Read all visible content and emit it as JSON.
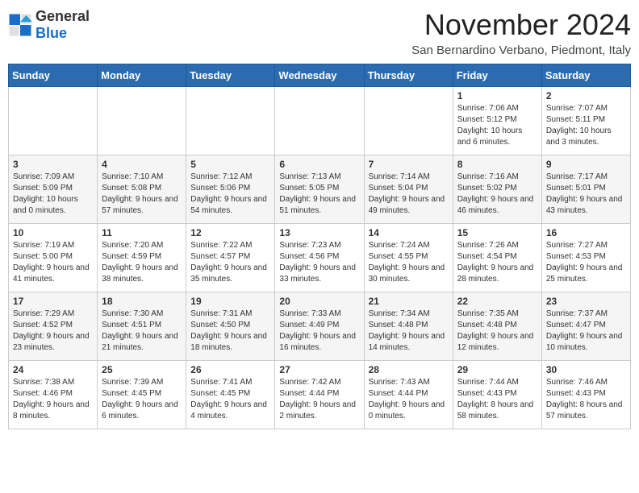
{
  "header": {
    "logo_general": "General",
    "logo_blue": "Blue",
    "month_title": "November 2024",
    "location": "San Bernardino Verbano, Piedmont, Italy"
  },
  "calendar": {
    "weekdays": [
      "Sunday",
      "Monday",
      "Tuesday",
      "Wednesday",
      "Thursday",
      "Friday",
      "Saturday"
    ],
    "rows": [
      [
        {
          "day": "",
          "info": ""
        },
        {
          "day": "",
          "info": ""
        },
        {
          "day": "",
          "info": ""
        },
        {
          "day": "",
          "info": ""
        },
        {
          "day": "",
          "info": ""
        },
        {
          "day": "1",
          "info": "Sunrise: 7:06 AM\nSunset: 5:12 PM\nDaylight: 10 hours and 6 minutes."
        },
        {
          "day": "2",
          "info": "Sunrise: 7:07 AM\nSunset: 5:11 PM\nDaylight: 10 hours and 3 minutes."
        }
      ],
      [
        {
          "day": "3",
          "info": "Sunrise: 7:09 AM\nSunset: 5:09 PM\nDaylight: 10 hours and 0 minutes."
        },
        {
          "day": "4",
          "info": "Sunrise: 7:10 AM\nSunset: 5:08 PM\nDaylight: 9 hours and 57 minutes."
        },
        {
          "day": "5",
          "info": "Sunrise: 7:12 AM\nSunset: 5:06 PM\nDaylight: 9 hours and 54 minutes."
        },
        {
          "day": "6",
          "info": "Sunrise: 7:13 AM\nSunset: 5:05 PM\nDaylight: 9 hours and 51 minutes."
        },
        {
          "day": "7",
          "info": "Sunrise: 7:14 AM\nSunset: 5:04 PM\nDaylight: 9 hours and 49 minutes."
        },
        {
          "day": "8",
          "info": "Sunrise: 7:16 AM\nSunset: 5:02 PM\nDaylight: 9 hours and 46 minutes."
        },
        {
          "day": "9",
          "info": "Sunrise: 7:17 AM\nSunset: 5:01 PM\nDaylight: 9 hours and 43 minutes."
        }
      ],
      [
        {
          "day": "10",
          "info": "Sunrise: 7:19 AM\nSunset: 5:00 PM\nDaylight: 9 hours and 41 minutes."
        },
        {
          "day": "11",
          "info": "Sunrise: 7:20 AM\nSunset: 4:59 PM\nDaylight: 9 hours and 38 minutes."
        },
        {
          "day": "12",
          "info": "Sunrise: 7:22 AM\nSunset: 4:57 PM\nDaylight: 9 hours and 35 minutes."
        },
        {
          "day": "13",
          "info": "Sunrise: 7:23 AM\nSunset: 4:56 PM\nDaylight: 9 hours and 33 minutes."
        },
        {
          "day": "14",
          "info": "Sunrise: 7:24 AM\nSunset: 4:55 PM\nDaylight: 9 hours and 30 minutes."
        },
        {
          "day": "15",
          "info": "Sunrise: 7:26 AM\nSunset: 4:54 PM\nDaylight: 9 hours and 28 minutes."
        },
        {
          "day": "16",
          "info": "Sunrise: 7:27 AM\nSunset: 4:53 PM\nDaylight: 9 hours and 25 minutes."
        }
      ],
      [
        {
          "day": "17",
          "info": "Sunrise: 7:29 AM\nSunset: 4:52 PM\nDaylight: 9 hours and 23 minutes."
        },
        {
          "day": "18",
          "info": "Sunrise: 7:30 AM\nSunset: 4:51 PM\nDaylight: 9 hours and 21 minutes."
        },
        {
          "day": "19",
          "info": "Sunrise: 7:31 AM\nSunset: 4:50 PM\nDaylight: 9 hours and 18 minutes."
        },
        {
          "day": "20",
          "info": "Sunrise: 7:33 AM\nSunset: 4:49 PM\nDaylight: 9 hours and 16 minutes."
        },
        {
          "day": "21",
          "info": "Sunrise: 7:34 AM\nSunset: 4:48 PM\nDaylight: 9 hours and 14 minutes."
        },
        {
          "day": "22",
          "info": "Sunrise: 7:35 AM\nSunset: 4:48 PM\nDaylight: 9 hours and 12 minutes."
        },
        {
          "day": "23",
          "info": "Sunrise: 7:37 AM\nSunset: 4:47 PM\nDaylight: 9 hours and 10 minutes."
        }
      ],
      [
        {
          "day": "24",
          "info": "Sunrise: 7:38 AM\nSunset: 4:46 PM\nDaylight: 9 hours and 8 minutes."
        },
        {
          "day": "25",
          "info": "Sunrise: 7:39 AM\nSunset: 4:45 PM\nDaylight: 9 hours and 6 minutes."
        },
        {
          "day": "26",
          "info": "Sunrise: 7:41 AM\nSunset: 4:45 PM\nDaylight: 9 hours and 4 minutes."
        },
        {
          "day": "27",
          "info": "Sunrise: 7:42 AM\nSunset: 4:44 PM\nDaylight: 9 hours and 2 minutes."
        },
        {
          "day": "28",
          "info": "Sunrise: 7:43 AM\nSunset: 4:44 PM\nDaylight: 9 hours and 0 minutes."
        },
        {
          "day": "29",
          "info": "Sunrise: 7:44 AM\nSunset: 4:43 PM\nDaylight: 8 hours and 58 minutes."
        },
        {
          "day": "30",
          "info": "Sunrise: 7:46 AM\nSunset: 4:43 PM\nDaylight: 8 hours and 57 minutes."
        }
      ]
    ]
  }
}
